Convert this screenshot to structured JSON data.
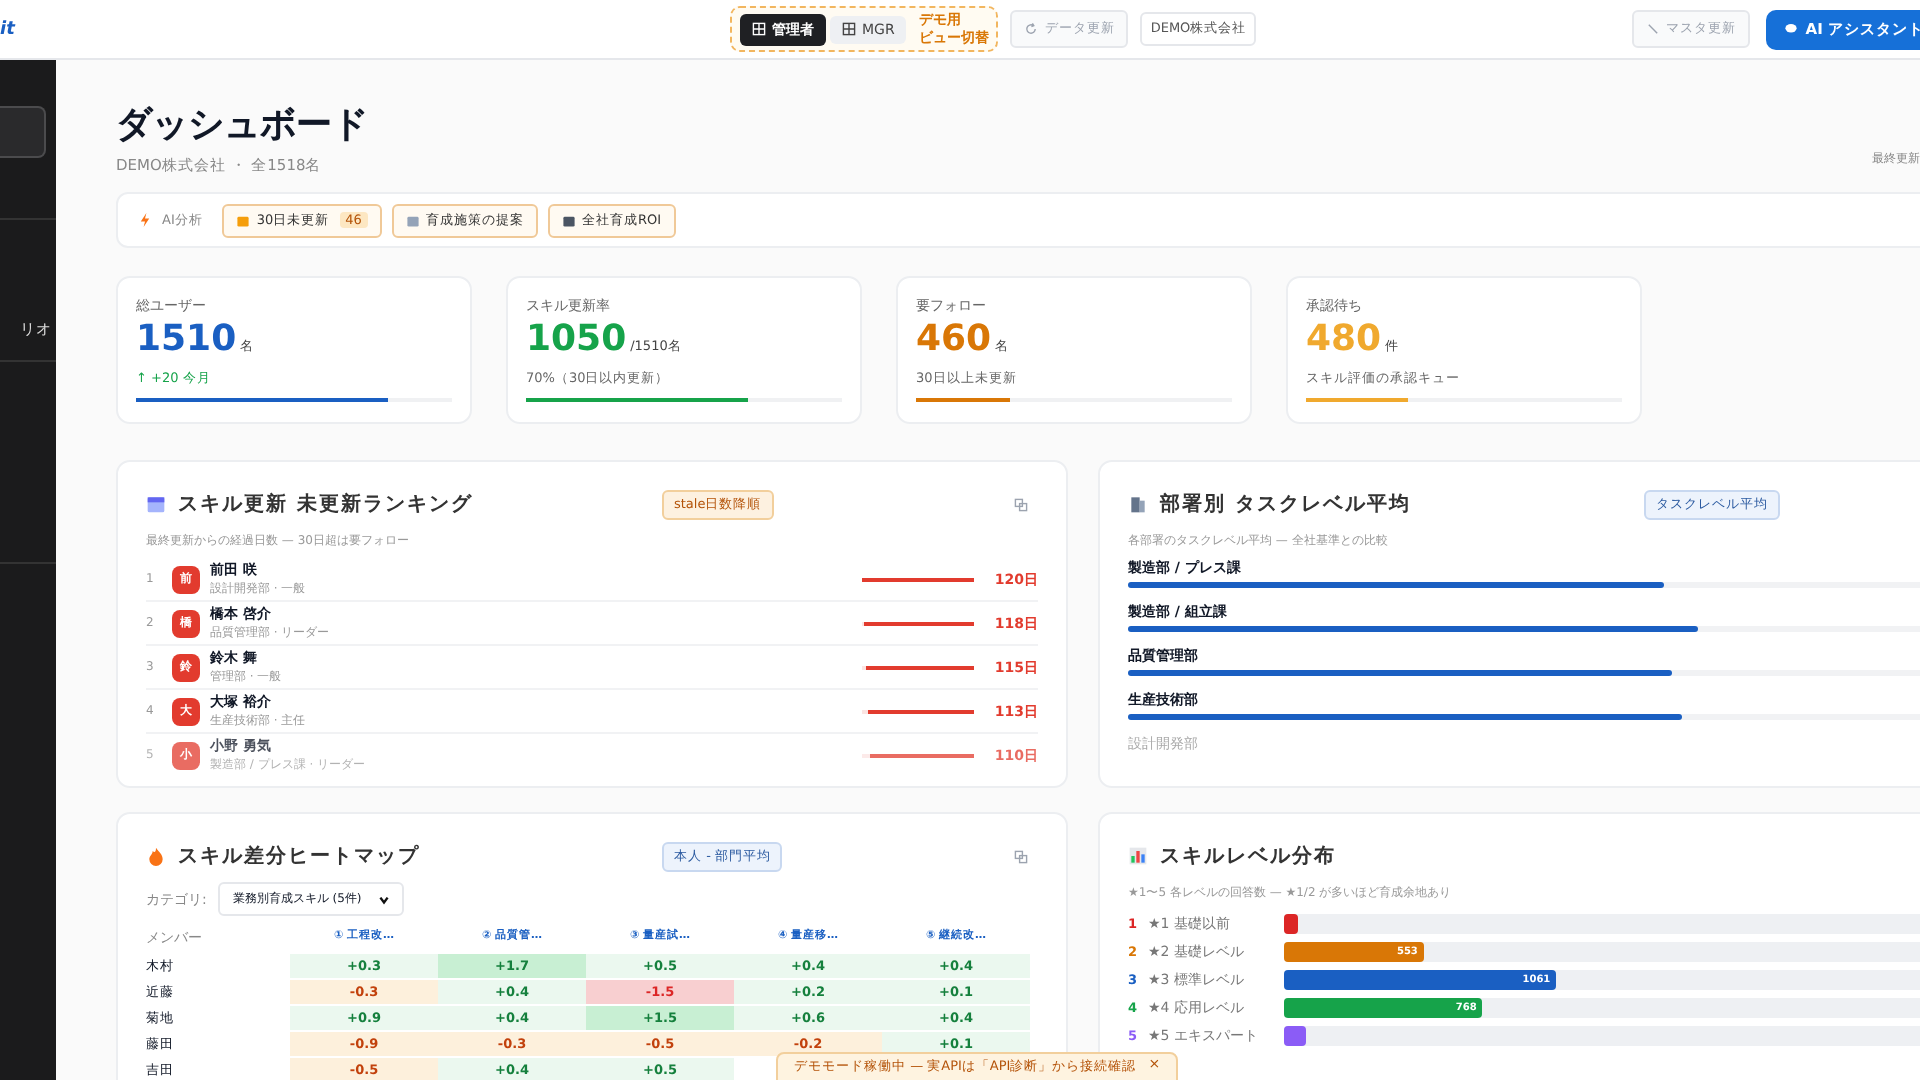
{
  "logo": "it",
  "view_switch": {
    "options": [
      {
        "label": "管理者",
        "selected": true
      },
      {
        "label": "MGR",
        "selected": false
      }
    ],
    "note": [
      "デモ用",
      "ビュー切替"
    ]
  },
  "refresh_button": {
    "label": "データ更新",
    "disabled": true
  },
  "company_tag": "DEMO株式会社",
  "master_button": {
    "label": "マスタ更新",
    "disabled": true
  },
  "assistant_button": "AI アシスタント",
  "sidebar": {
    "item": "リオ"
  },
  "page": {
    "title": "ダッシュボード",
    "subtitle": "DEMO株式会社 ・ 全1518名",
    "updated": "最終更新"
  },
  "ai_bar": {
    "label": "AI分析",
    "actions": [
      {
        "label": "30日未更新",
        "count": "46"
      },
      {
        "label": "育成施策の提案"
      },
      {
        "label": "全社育成ROI"
      }
    ]
  },
  "kpis": [
    {
      "label": "総ユーザー",
      "value": "1510",
      "unit": "名",
      "note": "↑ +20 今月",
      "trend_up": true,
      "color": "#1a5fc2",
      "level": 0.8
    },
    {
      "label": "スキル更新率",
      "value": "1050",
      "unit": "/1510名",
      "note": "70%（30日以内更新）",
      "trend_up": false,
      "color": "#16a34a",
      "level": 0.7
    },
    {
      "label": "要フォロー",
      "value": "460",
      "unit": "名",
      "note": "30日以上未更新",
      "trend_up": false,
      "color": "#d97706",
      "level": 0.3
    },
    {
      "label": "承認待ち",
      "value": "480",
      "unit": "件",
      "note": "スキル評価の承認キュー",
      "trend_up": false,
      "color": "#f0a92e",
      "level": 0.32
    }
  ],
  "ranking": {
    "title": "スキル更新 未更新ランキング",
    "badge": "stale日数降順",
    "subtitle": "最終更新からの経過日数 — 30日超は要フォロー",
    "rows": [
      {
        "rank": "1",
        "initial": "前",
        "name": "前田 咲",
        "sub": "設計開発部 · 一般",
        "days": "120日",
        "level": 1
      },
      {
        "rank": "2",
        "initial": "橋",
        "name": "橋本 啓介",
        "sub": "品質管理部 · リーダー",
        "days": "118日",
        "level": 0.98
      },
      {
        "rank": "3",
        "initial": "鈴",
        "name": "鈴木 舞",
        "sub": "管理部 · 一般",
        "days": "115日",
        "level": 0.96
      },
      {
        "rank": "4",
        "initial": "大",
        "name": "大塚 裕介",
        "sub": "生産技術部 · 主任",
        "days": "113日",
        "level": 0.94
      },
      {
        "rank": "5",
        "initial": "小",
        "name": "小野 勇気",
        "sub": "製造部 / プレス課 · リーダー",
        "days": "110日",
        "level": 0.92
      }
    ]
  },
  "departments": {
    "title": "部署別 タスクレベル平均",
    "badge": "タスクレベル平均",
    "subtitle": "各部署のタスクレベル平均 — 全社基準との比較",
    "rows": [
      {
        "name": "製造部 / プレス課",
        "level": 0.6
      },
      {
        "name": "製造部 / 組立課",
        "level": 0.64
      },
      {
        "name": "品質管理部",
        "level": 0.61
      },
      {
        "name": "生産技術部",
        "level": 0.62
      },
      {
        "name": "設計開発部"
      }
    ]
  },
  "heatmap": {
    "title": "スキル差分ヒートマップ",
    "badge": "本人 - 部門平均",
    "category_label": "カテゴリ:",
    "category": "業務別育成スキル (5件)",
    "columns": [
      "メンバー",
      "① 工程改…",
      "② 品質管…",
      "③ 量産試…",
      "④ 量産移…",
      "⑤ 継続改…"
    ],
    "rows": [
      {
        "name": "木村",
        "values": [
          "+0.3",
          "+1.7",
          "+0.5",
          "+0.4",
          "+0.4"
        ]
      },
      {
        "name": "近藤",
        "values": [
          "-0.3",
          "+0.4",
          "-1.5",
          "+0.2",
          "+0.1"
        ]
      },
      {
        "name": "菊地",
        "values": [
          "+0.9",
          "+0.4",
          "+1.5",
          "+0.6",
          "+0.4"
        ]
      },
      {
        "name": "藤田",
        "values": [
          "-0.9",
          "-0.3",
          "-0.5",
          "-0.2",
          "+0.1"
        ]
      },
      {
        "name": "吉田",
        "values": [
          "-0.5",
          "+0.4",
          "+0.5"
        ]
      }
    ]
  },
  "distribution": {
    "title": "スキルレベル分布",
    "subtitle": "★1〜5 各レベルの回答数 — ★1/2 が多いほど育成余地あり",
    "rows": [
      {
        "num": "1",
        "label": "★1 基礎以前",
        "color": "#dc2626",
        "level": 0.02
      },
      {
        "num": "2",
        "label": "★2 基礎レベル",
        "color": "#d97706",
        "level": 0.19,
        "count": "553"
      },
      {
        "num": "3",
        "label": "★3 標準レベル",
        "color": "#1a5fc2",
        "level": 0.37,
        "count": "1061"
      },
      {
        "num": "4",
        "label": "★4 応用レベル",
        "color": "#16a34a",
        "level": 0.27,
        "count": "768"
      },
      {
        "num": "5",
        "label": "★5 エキスパート",
        "color": "#8b5cf6",
        "level": 0.03
      }
    ]
  },
  "toast": "デモモード稼働中 — 実APIは「API診断」から接続確認",
  "toast_close": "×"
}
